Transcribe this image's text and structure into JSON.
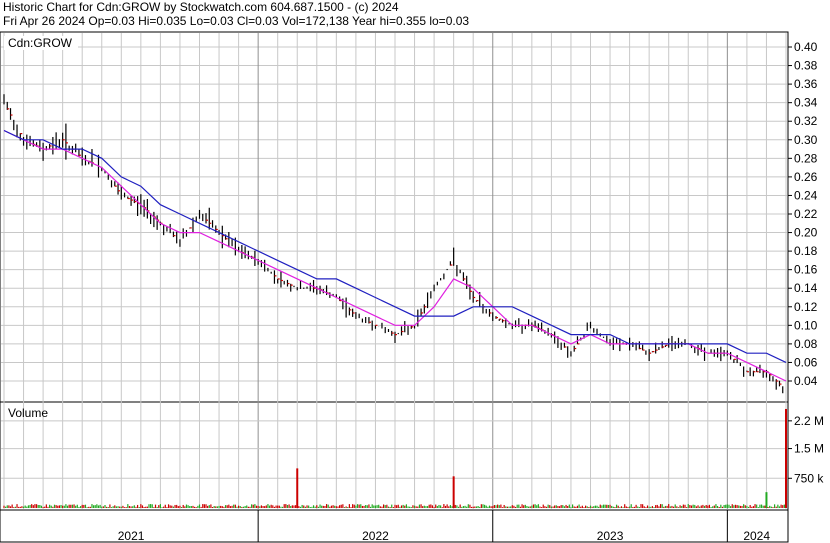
{
  "header": {
    "line1": "Historic Chart for Cdn:GROW by Stockwatch.com 604.687.1500 - (c) 2024",
    "line2": "Fri Apr 26 2024   Op=0.03   Hi=0.035   Lo=0.03   Cl=0.03   Vol=172,138   Year hi=0.355   lo=0.03"
  },
  "colors": {
    "price_bar": "#000000",
    "down_marker": "#cc0000",
    "ma_short": "#e020e0",
    "ma_long": "#2020c0",
    "grid": "#c8c8c8",
    "volume_up": "#22aa22",
    "volume_down": "#cc0000"
  },
  "chart_data": [
    {
      "type": "line",
      "panel_label": "Cdn:GROW",
      "y_ticks": [
        "0.40",
        "0.38",
        "0.36",
        "0.34",
        "0.32",
        "0.30",
        "0.28",
        "0.26",
        "0.24",
        "0.22",
        "0.20",
        "0.18",
        "0.16",
        "0.14",
        "0.12",
        "0.10",
        "0.08",
        "0.06",
        "0.04"
      ],
      "ylim": [
        0.02,
        0.41
      ],
      "x_labels": [
        "2021",
        "2022",
        "2023",
        "2024"
      ],
      "series": [
        {
          "name": "",
          "x": [
            "2020-12",
            "2021-01",
            "2021-02",
            "2021-03",
            "2021-04",
            "2021-05",
            "2021-06",
            "2021-07",
            "2021-08",
            "2021-09",
            "2021-10",
            "2021-11",
            "2021-12",
            "2022-01",
            "2022-02",
            "2022-03",
            "2022-04",
            "2022-05",
            "2022-06",
            "2022-07",
            "2022-08",
            "2022-09",
            "2022-10",
            "2022-11",
            "2022-12",
            "2023-01",
            "2023-02",
            "2023-03",
            "2023-04",
            "2023-05",
            "2023-06",
            "2023-07",
            "2023-08",
            "2023-09",
            "2023-10",
            "2023-11",
            "2023-12",
            "2024-01",
            "2024-02",
            "2024-03",
            "2024-04"
          ],
          "values": [
            0.34,
            0.3,
            0.29,
            0.3,
            0.28,
            0.27,
            0.24,
            0.23,
            0.21,
            0.19,
            0.22,
            0.2,
            0.18,
            0.17,
            0.15,
            0.14,
            0.14,
            0.13,
            0.11,
            0.1,
            0.09,
            0.1,
            0.14,
            0.17,
            0.13,
            0.11,
            0.1,
            0.1,
            0.09,
            0.07,
            0.1,
            0.08,
            0.08,
            0.07,
            0.08,
            0.08,
            0.07,
            0.07,
            0.05,
            0.05,
            0.03
          ]
        },
        {
          "name": "",
          "values": [
            0.31,
            0.3,
            0.29,
            0.29,
            0.28,
            0.27,
            0.25,
            0.23,
            0.21,
            0.2,
            0.2,
            0.19,
            0.18,
            0.17,
            0.16,
            0.15,
            0.14,
            0.13,
            0.12,
            0.11,
            0.1,
            0.1,
            0.12,
            0.15,
            0.14,
            0.12,
            0.1,
            0.1,
            0.09,
            0.08,
            0.09,
            0.08,
            0.08,
            0.08,
            0.08,
            0.08,
            0.07,
            0.07,
            0.06,
            0.05,
            0.04
          ]
        },
        {
          "name": "",
          "values": [
            0.31,
            0.3,
            0.3,
            0.29,
            0.29,
            0.28,
            0.26,
            0.25,
            0.23,
            0.22,
            0.21,
            0.2,
            0.19,
            0.18,
            0.17,
            0.16,
            0.15,
            0.15,
            0.14,
            0.13,
            0.12,
            0.11,
            0.11,
            0.11,
            0.12,
            0.12,
            0.12,
            0.11,
            0.1,
            0.09,
            0.09,
            0.09,
            0.08,
            0.08,
            0.08,
            0.08,
            0.08,
            0.08,
            0.07,
            0.07,
            0.06
          ]
        }
      ]
    },
    {
      "type": "bar",
      "panel_label": "Volume",
      "y_ticks": [
        "2.2 M",
        "1.5 M",
        "750 k"
      ],
      "ylim": [
        0,
        2.6
      ],
      "values_unit": "M",
      "spikes": [
        {
          "month": "2022-03",
          "value": 1.0,
          "color": "red"
        },
        {
          "month": "2022-11",
          "value": 0.8,
          "color": "red"
        },
        {
          "month": "2024-04",
          "value": 2.5,
          "color": "red"
        },
        {
          "month": "2024-03",
          "value": 0.4,
          "color": "green"
        }
      ]
    }
  ]
}
